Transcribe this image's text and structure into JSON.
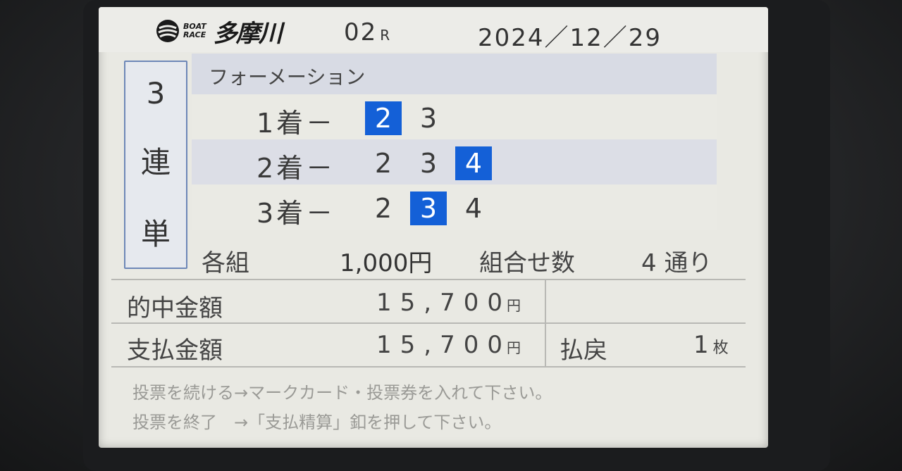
{
  "header": {
    "brand_top": "BOAT",
    "brand_bottom": "RACE",
    "venue": "多摩川",
    "race_number": "02",
    "race_suffix": "R",
    "date": "2024／12／29"
  },
  "bet_type": [
    "3",
    "連",
    "単"
  ],
  "method": "フォーメーション",
  "picks": [
    {
      "label": "1着－",
      "boats": [
        {
          "n": "2",
          "selected": true
        },
        {
          "n": "3",
          "selected": false
        }
      ]
    },
    {
      "label": "2着－",
      "boats": [
        {
          "n": "2",
          "selected": false
        },
        {
          "n": "3",
          "selected": false
        },
        {
          "n": "4",
          "selected": true
        }
      ]
    },
    {
      "label": "3着－",
      "boats": [
        {
          "n": "2",
          "selected": false
        },
        {
          "n": "3",
          "selected": true
        },
        {
          "n": "4",
          "selected": false
        }
      ]
    }
  ],
  "amount": {
    "each_label": "各組",
    "each_value": "1,000円",
    "combos_label": "組合せ数",
    "combos_value": "4 通り"
  },
  "payout": {
    "hit_label": "的中金額",
    "hit_value": "15,700",
    "pay_label": "支払金額",
    "pay_value": "15,700",
    "yen": "円",
    "refund_label": "払戻",
    "refund_value": "1",
    "refund_unit": "枚"
  },
  "messages": [
    "投票を続ける→マークカード・投票券を入れて下さい。",
    "投票を終了　→「支払精算」釦を押して下さい。"
  ],
  "colors": {
    "selected_boat": "#1460d7",
    "screen_bg": "#e9e9e3",
    "row_alt": "#dcdee6"
  }
}
